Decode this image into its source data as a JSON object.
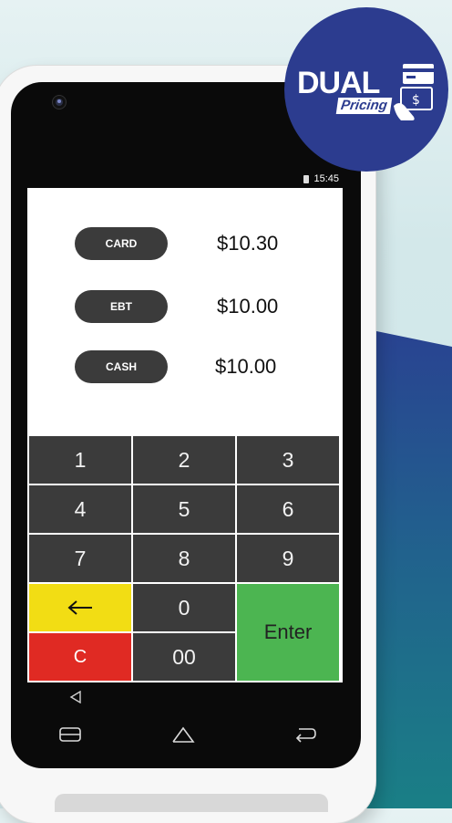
{
  "badge": {
    "title": "DUAL",
    "subtitle": "Pricing"
  },
  "status_bar": {
    "time": "15:45"
  },
  "prices": [
    {
      "label": "CARD",
      "amount": "$10.30"
    },
    {
      "label": "EBT",
      "amount": "$10.00"
    },
    {
      "label": "CASH",
      "amount": "$10.00"
    }
  ],
  "keypad": {
    "k1": "1",
    "k2": "2",
    "k3": "3",
    "k4": "4",
    "k5": "5",
    "k6": "6",
    "k7": "7",
    "k8": "8",
    "k9": "9",
    "k0": "0",
    "k00": "00",
    "clear": "C",
    "enter": "Enter",
    "back_icon": "left-arrow-icon"
  },
  "colors": {
    "badge": "#2c3c8f",
    "key_dark": "#3b3b3b",
    "key_back": "#f2dd14",
    "key_clear": "#e02a23",
    "key_enter": "#4cb551",
    "background_wave": "#1f5d8e"
  },
  "navbar_icons": [
    "back-triangle-icon",
    "recents-icon",
    "home-icon",
    "return-icon"
  ]
}
